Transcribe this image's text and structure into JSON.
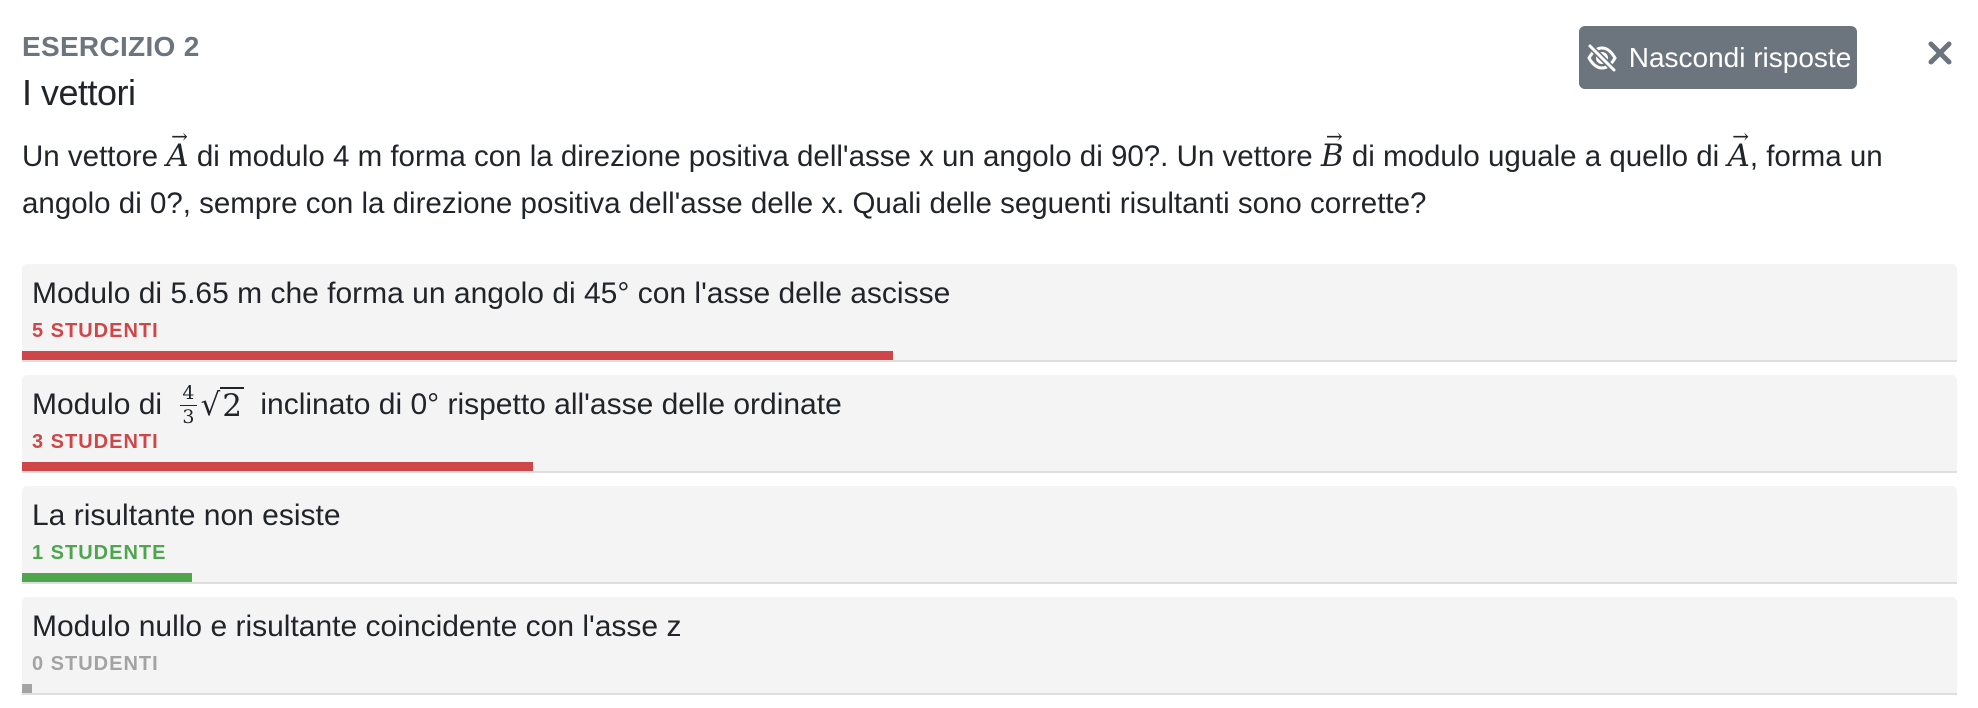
{
  "header": {
    "eyebrow": "ESERCIZIO 2",
    "title": "I vettori",
    "hide_answers_label": "Nascondi risposte"
  },
  "question": {
    "part1": "Un vettore ",
    "vector_a": "A",
    "part2": " di modulo 4 m forma con la direzione positiva dell'asse x un angolo di 90?. Un vettore ",
    "vector_b": "B",
    "part3": " di modulo uguale a quello di ",
    "vector_a2": "A",
    "part4": ", forma un angolo di 0?, sempre con la direzione positiva dell'asse delle x. Quali delle seguenti risultanti sono corrette?",
    "arrow_glyph": "→"
  },
  "colors": {
    "wrong": "#cf4649",
    "correct": "#4ea54e",
    "none": "#a3a3a3",
    "button": "#6c757d"
  },
  "icons": {
    "hide": "eye-slash-icon",
    "close": "close-icon"
  },
  "options": [
    {
      "label": "Modulo di 5.65 m che forma un angolo di 45° con l'asse delle ascisse",
      "count_label": "5 STUDENTI",
      "status": "wrong",
      "share": 0.45
    },
    {
      "label_prefix": "Modulo di ",
      "frac_num": "4",
      "frac_den": "3",
      "sqrt_symbol": "√",
      "sqrt_arg": "2",
      "label_suffix": " inclinato di 0° rispetto all'asse delle ordinate",
      "count_label": "3 STUDENTI",
      "status": "wrong",
      "share": 0.264
    },
    {
      "label": "La risultante non esiste",
      "count_label": "1 STUDENTE",
      "status": "correct",
      "share": 0.088
    },
    {
      "label": "Modulo nullo e risultante coincidente con l'asse z",
      "count_label": "0 STUDENTI",
      "status": "none",
      "share": 0.005
    }
  ]
}
